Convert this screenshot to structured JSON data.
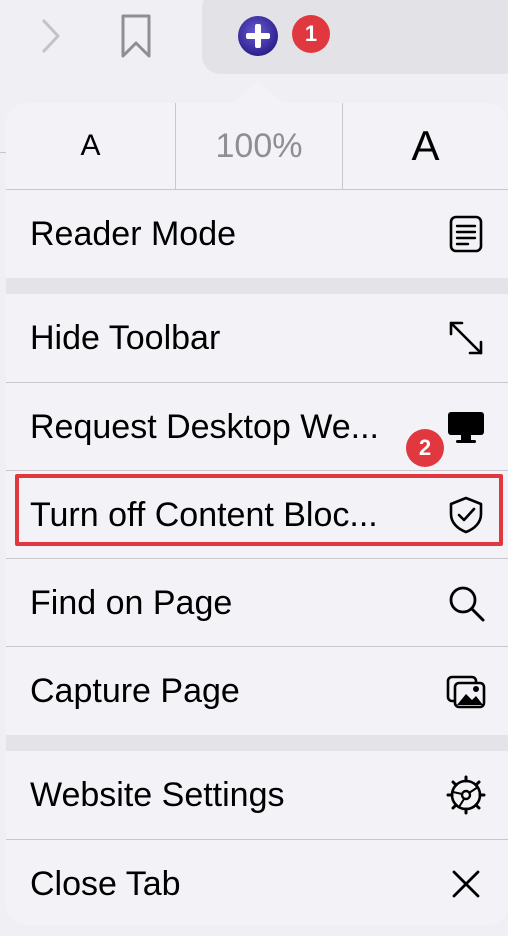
{
  "toolbar": {
    "forward_icon": "chevron-right-icon",
    "bookmark_icon": "bookmark-icon",
    "extension_icon": "extension-plus-icon"
  },
  "badges": {
    "step1": "1",
    "step2": "2",
    "color": "#e0383e"
  },
  "font_controls": {
    "smaller": "A",
    "zoom": "100%",
    "larger": "A"
  },
  "menu": {
    "reader_mode": "Reader Mode",
    "hide_toolbar": "Hide Toolbar",
    "request_desktop": "Request Desktop We...",
    "content_blockers": "Turn off Content Bloc...",
    "find_on_page": "Find on Page",
    "capture_page": "Capture Page",
    "website_settings": "Website Settings",
    "close_tab": "Close Tab"
  }
}
